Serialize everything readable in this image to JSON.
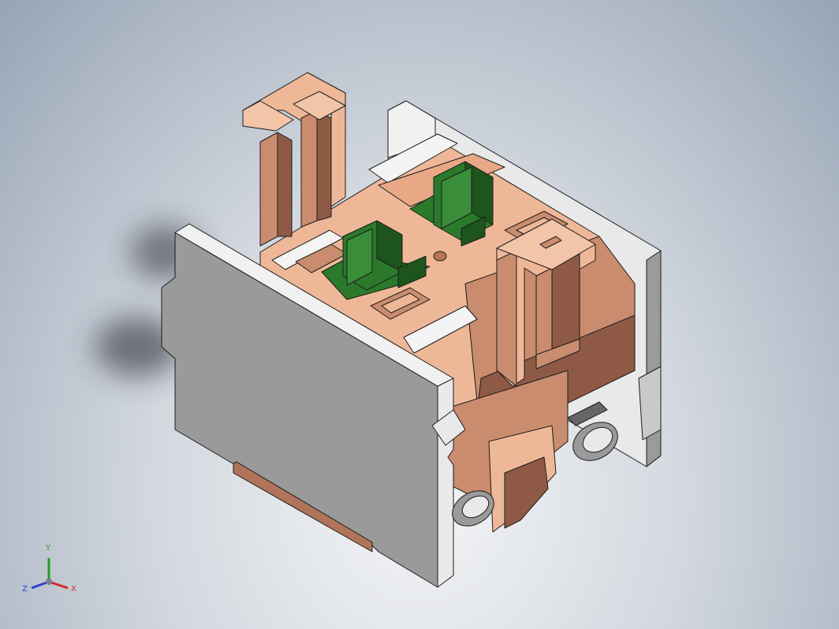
{
  "scene": {
    "subject": "contact-block-3d-model",
    "colors": {
      "background_light": "#f4f5f7",
      "background_dark": "#97a4b6",
      "housing_light": "#e9e9e9",
      "housing_side": "#9a9a9a",
      "copper_light": "#eeb898",
      "copper_mid": "#c98c6e",
      "copper_dark": "#8e5a45",
      "actuator_green": "#2b7a2b",
      "actuator_dark": "#1d551d",
      "edge": "#1c1c1c"
    }
  },
  "triad": {
    "x_label": "X",
    "y_label": "Y",
    "z_label": "Z",
    "x_color": "#d42a2a",
    "y_color": "#22a022",
    "z_color": "#2a42d4"
  }
}
